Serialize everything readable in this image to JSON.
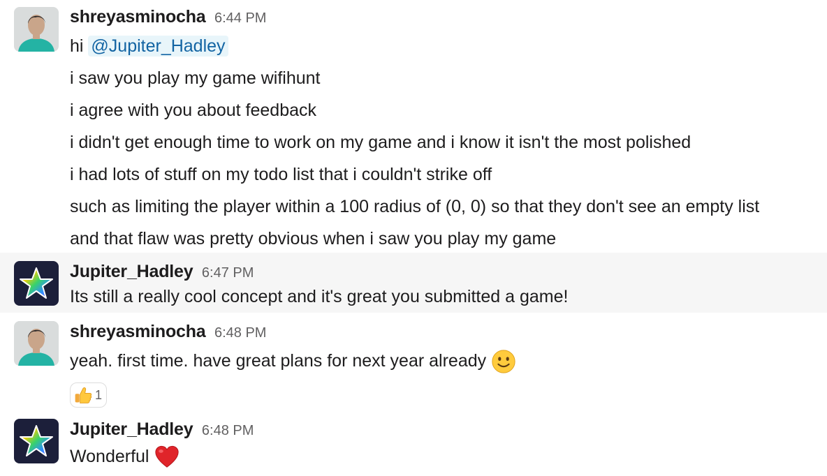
{
  "messages": [
    {
      "author": "shreyasminocha",
      "time": "6:44 PM",
      "avatar_icon": "person-avatar-icon",
      "lines": [
        {
          "prefix": "hi ",
          "mention": "@Jupiter_Hadley"
        },
        {
          "text": "i saw you play my game wifihunt"
        },
        {
          "text": "i agree with you about feedback"
        },
        {
          "text": "i didn't get enough time to work on my game and i know it isn't the most polished"
        },
        {
          "text": "i had lots of stuff on my todo list that i couldn't strike off"
        },
        {
          "text": "such as limiting the player within a 100 radius of (0, 0) so that they don't see an empty list"
        },
        {
          "text": "and that flaw was pretty obvious when i saw you play my game"
        }
      ]
    },
    {
      "author": "Jupiter_Hadley",
      "time": "6:47 PM",
      "avatar_icon": "rainbow-star-avatar-icon",
      "lines": [
        {
          "text": "Its still a really cool concept and it's great you submitted a game!"
        }
      ]
    },
    {
      "author": "shreyasminocha",
      "time": "6:48 PM",
      "avatar_icon": "person-avatar-icon",
      "lines": [
        {
          "text": "yeah. first time. have great plans for next year already",
          "emoji": "slightly-smiling-face-icon"
        }
      ],
      "reaction": {
        "icon": "thumbs-up-icon",
        "count": "1"
      }
    },
    {
      "author": "Jupiter_Hadley",
      "time": "6:48 PM",
      "avatar_icon": "rainbow-star-avatar-icon",
      "lines": [
        {
          "text": "Wonderful",
          "emoji": "red-heart-icon"
        }
      ]
    }
  ],
  "colors": {
    "mention_text": "#1264a3",
    "mention_bg": "#e8f5fa",
    "timestamp": "#616061",
    "hover_bg": "#f6f6f6"
  }
}
